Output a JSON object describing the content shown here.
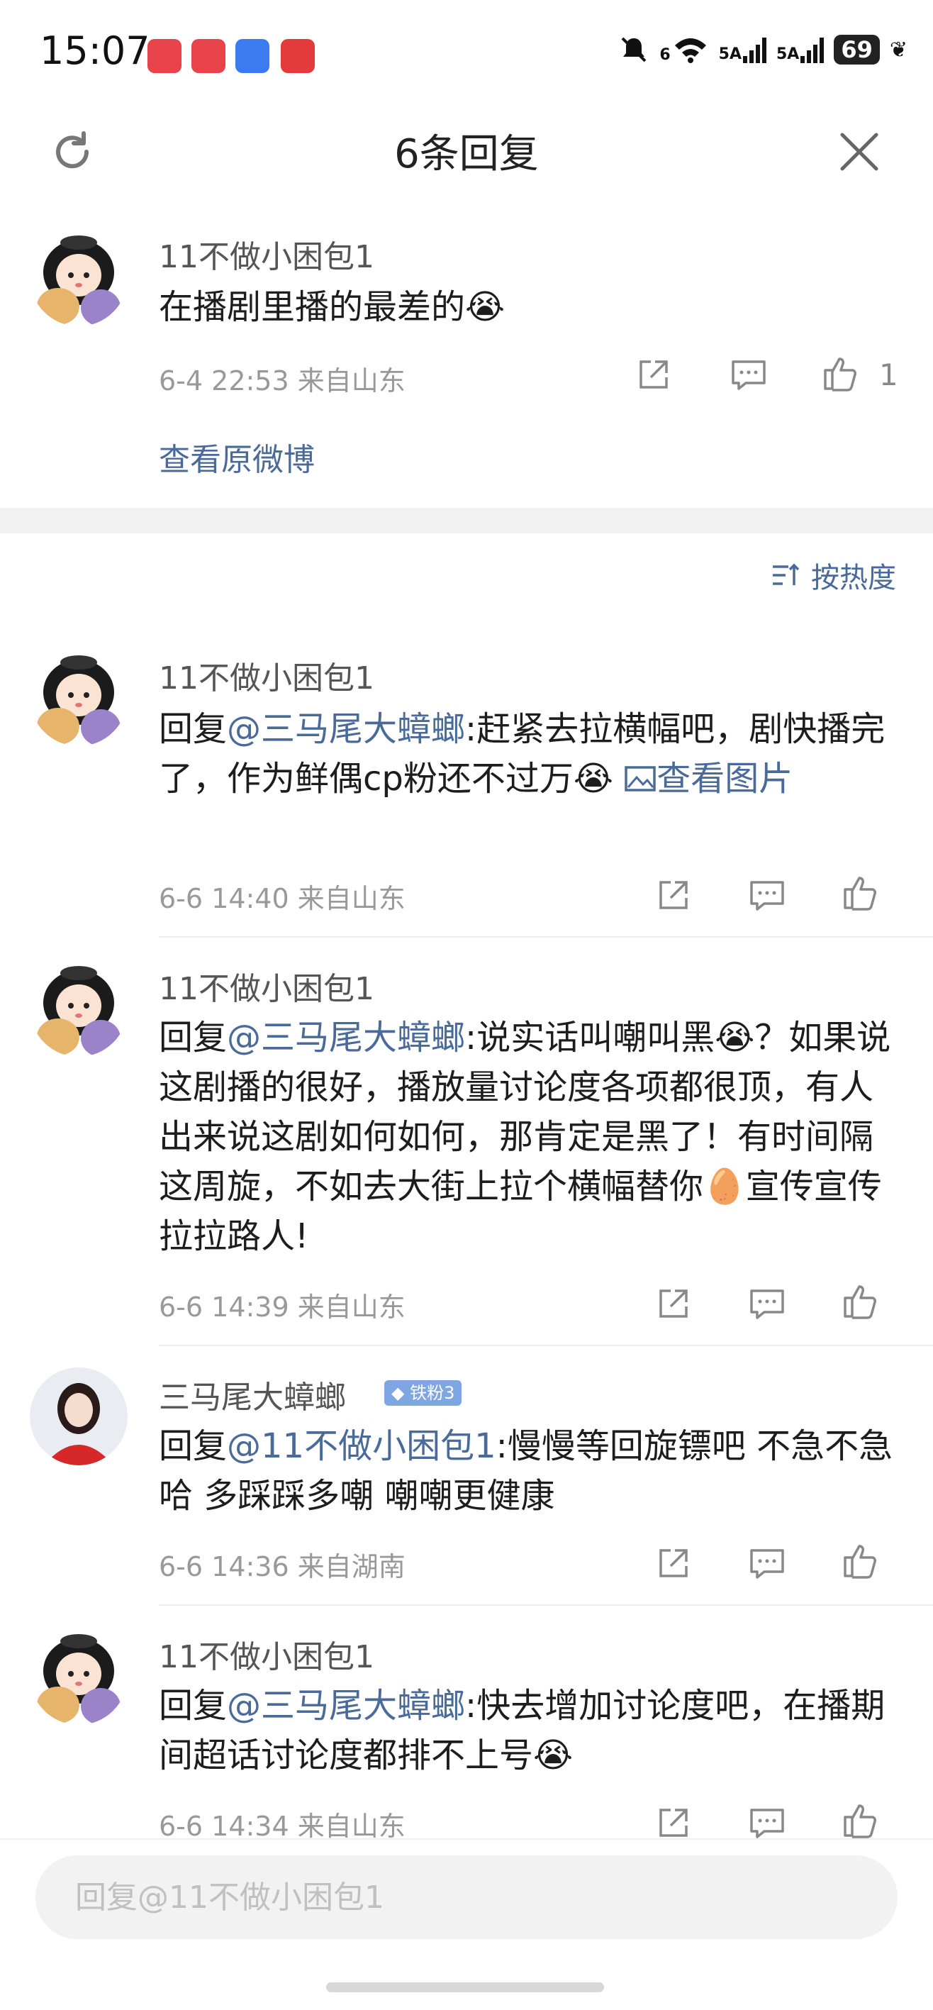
{
  "status_bar": {
    "time": "15:07",
    "battery": "69",
    "net1": "5A",
    "net2": "5A",
    "wifi_label": "6"
  },
  "header": {
    "title": "6条回复"
  },
  "original": {
    "username": "11不做小困包1",
    "text": "在播剧里播的最差的😭",
    "meta": "6-4 22:53 来自山东",
    "like_count": "1",
    "view_original": "查看原微博"
  },
  "sort": {
    "label": "按热度"
  },
  "replies": [
    {
      "username": "11不做小困包1",
      "prefix": "回复",
      "mention": "@三马尾大蟑螂",
      "text": ":赶紧去拉横幅吧，剧快播完了，作为鲜偶cp粉还不过万😭 ",
      "image_link": "查看图片",
      "meta": "6-6 14:40 来自山东"
    },
    {
      "username": "11不做小困包1",
      "prefix": "回复",
      "mention": "@三马尾大蟑螂",
      "text": ":说实话叫嘲叫黑😭？如果说这剧播的很好，播放量讨论度各项都很顶，有人出来说这剧如何如何，那肯定是黑了！有时间隔这周旋，不如去大街上拉个横幅替你🥚宣传宣传拉拉路人!",
      "meta": "6-6 14:39 来自山东"
    },
    {
      "username": "三马尾大蟑螂",
      "badge": "铁粉3",
      "prefix": "回复",
      "mention": "@11不做小困包1",
      "text": ":慢慢等回旋镖吧 不急不急哈 多踩踩多嘲 嘲嘲更健康",
      "meta": "6-6 14:36 来自湖南"
    },
    {
      "username": "11不做小困包1",
      "prefix": "回复",
      "mention": "@三马尾大蟑螂",
      "text": ":快去增加讨论度吧，在播期间超话讨论度都排不上号😭",
      "meta": "6-6 14:34 来自山东"
    }
  ],
  "input": {
    "placeholder": "回复@11不做小困包1"
  },
  "colors": {
    "link": "#4a6a9a",
    "meta": "#999999",
    "badge": "#7ea6e0"
  }
}
